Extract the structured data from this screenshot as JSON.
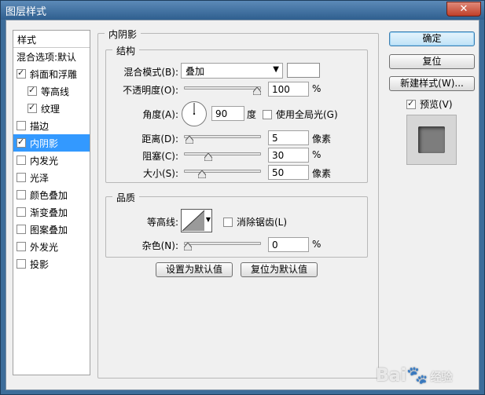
{
  "window": {
    "title": "图层样式",
    "close_glyph": "✕"
  },
  "style_list": {
    "header": "样式",
    "items": [
      {
        "label": "混合选项:默认",
        "checkbox": false,
        "checked": false,
        "indent": false,
        "selected": false
      },
      {
        "label": "斜面和浮雕",
        "checkbox": true,
        "checked": true,
        "indent": false,
        "selected": false
      },
      {
        "label": "等高线",
        "checkbox": true,
        "checked": true,
        "indent": true,
        "selected": false
      },
      {
        "label": "纹理",
        "checkbox": true,
        "checked": true,
        "indent": true,
        "selected": false
      },
      {
        "label": "描边",
        "checkbox": true,
        "checked": false,
        "indent": false,
        "selected": false
      },
      {
        "label": "内阴影",
        "checkbox": true,
        "checked": true,
        "indent": false,
        "selected": true
      },
      {
        "label": "内发光",
        "checkbox": true,
        "checked": false,
        "indent": false,
        "selected": false
      },
      {
        "label": "光泽",
        "checkbox": true,
        "checked": false,
        "indent": false,
        "selected": false
      },
      {
        "label": "颜色叠加",
        "checkbox": true,
        "checked": false,
        "indent": false,
        "selected": false
      },
      {
        "label": "渐变叠加",
        "checkbox": true,
        "checked": false,
        "indent": false,
        "selected": false
      },
      {
        "label": "图案叠加",
        "checkbox": true,
        "checked": false,
        "indent": false,
        "selected": false
      },
      {
        "label": "外发光",
        "checkbox": true,
        "checked": false,
        "indent": false,
        "selected": false
      },
      {
        "label": "投影",
        "checkbox": true,
        "checked": false,
        "indent": false,
        "selected": false
      }
    ]
  },
  "panel": {
    "title": "内阴影",
    "structure": {
      "legend": "结构",
      "blend_mode_label": "混合模式(B):",
      "blend_mode_value": "叠加",
      "opacity_label": "不透明度(O):",
      "opacity_value": "100",
      "opacity_unit": "%",
      "opacity_fraction": 1.0,
      "angle_label": "角度(A):",
      "angle_value": "90",
      "angle_unit": "度",
      "global_light_label": "使用全局光(G)",
      "global_light_checked": false,
      "distance_label": "距离(D):",
      "distance_value": "5",
      "distance_unit": "像素",
      "distance_fraction": 0.02,
      "choke_label": "阻塞(C):",
      "choke_value": "30",
      "choke_unit": "%",
      "choke_fraction": 0.3,
      "size_label": "大小(S):",
      "size_value": "50",
      "size_unit": "像素",
      "size_fraction": 0.2
    },
    "quality": {
      "legend": "品质",
      "contour_label": "等高线:",
      "anti_alias_label": "消除锯齿(L)",
      "anti_alias_checked": false,
      "noise_label": "杂色(N):",
      "noise_value": "0",
      "noise_unit": "%",
      "noise_fraction": 0.0
    },
    "set_default_label": "设置为默认值",
    "reset_default_label": "复位为默认值"
  },
  "right_buttons": {
    "ok_label": "确定",
    "reset_label": "复位",
    "new_style_label": "新建样式(W)...",
    "preview_label": "预览(V)",
    "preview_checked": true
  },
  "watermark": {
    "main": "Bai",
    "paw": "🐾",
    "tail": "经验"
  },
  "colors": {
    "titlebar": "#3d6d9a",
    "selection": "#3399ff",
    "swatch": "#ffffff"
  }
}
